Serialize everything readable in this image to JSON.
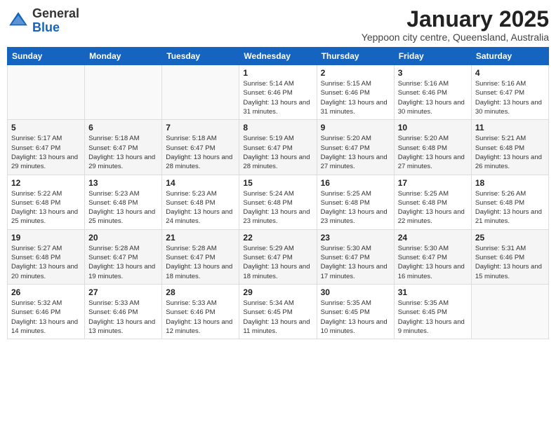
{
  "header": {
    "logo_general": "General",
    "logo_blue": "Blue",
    "month_title": "January 2025",
    "location": "Yeppoon city centre, Queensland, Australia"
  },
  "weekdays": [
    "Sunday",
    "Monday",
    "Tuesday",
    "Wednesday",
    "Thursday",
    "Friday",
    "Saturday"
  ],
  "weeks": [
    [
      {
        "day": "",
        "sunrise": "",
        "sunset": "",
        "daylight": ""
      },
      {
        "day": "",
        "sunrise": "",
        "sunset": "",
        "daylight": ""
      },
      {
        "day": "",
        "sunrise": "",
        "sunset": "",
        "daylight": ""
      },
      {
        "day": "1",
        "sunrise": "Sunrise: 5:14 AM",
        "sunset": "Sunset: 6:46 PM",
        "daylight": "Daylight: 13 hours and 31 minutes."
      },
      {
        "day": "2",
        "sunrise": "Sunrise: 5:15 AM",
        "sunset": "Sunset: 6:46 PM",
        "daylight": "Daylight: 13 hours and 31 minutes."
      },
      {
        "day": "3",
        "sunrise": "Sunrise: 5:16 AM",
        "sunset": "Sunset: 6:46 PM",
        "daylight": "Daylight: 13 hours and 30 minutes."
      },
      {
        "day": "4",
        "sunrise": "Sunrise: 5:16 AM",
        "sunset": "Sunset: 6:47 PM",
        "daylight": "Daylight: 13 hours and 30 minutes."
      }
    ],
    [
      {
        "day": "5",
        "sunrise": "Sunrise: 5:17 AM",
        "sunset": "Sunset: 6:47 PM",
        "daylight": "Daylight: 13 hours and 29 minutes."
      },
      {
        "day": "6",
        "sunrise": "Sunrise: 5:18 AM",
        "sunset": "Sunset: 6:47 PM",
        "daylight": "Daylight: 13 hours and 29 minutes."
      },
      {
        "day": "7",
        "sunrise": "Sunrise: 5:18 AM",
        "sunset": "Sunset: 6:47 PM",
        "daylight": "Daylight: 13 hours and 28 minutes."
      },
      {
        "day": "8",
        "sunrise": "Sunrise: 5:19 AM",
        "sunset": "Sunset: 6:47 PM",
        "daylight": "Daylight: 13 hours and 28 minutes."
      },
      {
        "day": "9",
        "sunrise": "Sunrise: 5:20 AM",
        "sunset": "Sunset: 6:47 PM",
        "daylight": "Daylight: 13 hours and 27 minutes."
      },
      {
        "day": "10",
        "sunrise": "Sunrise: 5:20 AM",
        "sunset": "Sunset: 6:48 PM",
        "daylight": "Daylight: 13 hours and 27 minutes."
      },
      {
        "day": "11",
        "sunrise": "Sunrise: 5:21 AM",
        "sunset": "Sunset: 6:48 PM",
        "daylight": "Daylight: 13 hours and 26 minutes."
      }
    ],
    [
      {
        "day": "12",
        "sunrise": "Sunrise: 5:22 AM",
        "sunset": "Sunset: 6:48 PM",
        "daylight": "Daylight: 13 hours and 25 minutes."
      },
      {
        "day": "13",
        "sunrise": "Sunrise: 5:23 AM",
        "sunset": "Sunset: 6:48 PM",
        "daylight": "Daylight: 13 hours and 25 minutes."
      },
      {
        "day": "14",
        "sunrise": "Sunrise: 5:23 AM",
        "sunset": "Sunset: 6:48 PM",
        "daylight": "Daylight: 13 hours and 24 minutes."
      },
      {
        "day": "15",
        "sunrise": "Sunrise: 5:24 AM",
        "sunset": "Sunset: 6:48 PM",
        "daylight": "Daylight: 13 hours and 23 minutes."
      },
      {
        "day": "16",
        "sunrise": "Sunrise: 5:25 AM",
        "sunset": "Sunset: 6:48 PM",
        "daylight": "Daylight: 13 hours and 23 minutes."
      },
      {
        "day": "17",
        "sunrise": "Sunrise: 5:25 AM",
        "sunset": "Sunset: 6:48 PM",
        "daylight": "Daylight: 13 hours and 22 minutes."
      },
      {
        "day": "18",
        "sunrise": "Sunrise: 5:26 AM",
        "sunset": "Sunset: 6:48 PM",
        "daylight": "Daylight: 13 hours and 21 minutes."
      }
    ],
    [
      {
        "day": "19",
        "sunrise": "Sunrise: 5:27 AM",
        "sunset": "Sunset: 6:48 PM",
        "daylight": "Daylight: 13 hours and 20 minutes."
      },
      {
        "day": "20",
        "sunrise": "Sunrise: 5:28 AM",
        "sunset": "Sunset: 6:47 PM",
        "daylight": "Daylight: 13 hours and 19 minutes."
      },
      {
        "day": "21",
        "sunrise": "Sunrise: 5:28 AM",
        "sunset": "Sunset: 6:47 PM",
        "daylight": "Daylight: 13 hours and 18 minutes."
      },
      {
        "day": "22",
        "sunrise": "Sunrise: 5:29 AM",
        "sunset": "Sunset: 6:47 PM",
        "daylight": "Daylight: 13 hours and 18 minutes."
      },
      {
        "day": "23",
        "sunrise": "Sunrise: 5:30 AM",
        "sunset": "Sunset: 6:47 PM",
        "daylight": "Daylight: 13 hours and 17 minutes."
      },
      {
        "day": "24",
        "sunrise": "Sunrise: 5:30 AM",
        "sunset": "Sunset: 6:47 PM",
        "daylight": "Daylight: 13 hours and 16 minutes."
      },
      {
        "day": "25",
        "sunrise": "Sunrise: 5:31 AM",
        "sunset": "Sunset: 6:46 PM",
        "daylight": "Daylight: 13 hours and 15 minutes."
      }
    ],
    [
      {
        "day": "26",
        "sunrise": "Sunrise: 5:32 AM",
        "sunset": "Sunset: 6:46 PM",
        "daylight": "Daylight: 13 hours and 14 minutes."
      },
      {
        "day": "27",
        "sunrise": "Sunrise: 5:33 AM",
        "sunset": "Sunset: 6:46 PM",
        "daylight": "Daylight: 13 hours and 13 minutes."
      },
      {
        "day": "28",
        "sunrise": "Sunrise: 5:33 AM",
        "sunset": "Sunset: 6:46 PM",
        "daylight": "Daylight: 13 hours and 12 minutes."
      },
      {
        "day": "29",
        "sunrise": "Sunrise: 5:34 AM",
        "sunset": "Sunset: 6:45 PM",
        "daylight": "Daylight: 13 hours and 11 minutes."
      },
      {
        "day": "30",
        "sunrise": "Sunrise: 5:35 AM",
        "sunset": "Sunset: 6:45 PM",
        "daylight": "Daylight: 13 hours and 10 minutes."
      },
      {
        "day": "31",
        "sunrise": "Sunrise: 5:35 AM",
        "sunset": "Sunset: 6:45 PM",
        "daylight": "Daylight: 13 hours and 9 minutes."
      },
      {
        "day": "",
        "sunrise": "",
        "sunset": "",
        "daylight": ""
      }
    ]
  ]
}
